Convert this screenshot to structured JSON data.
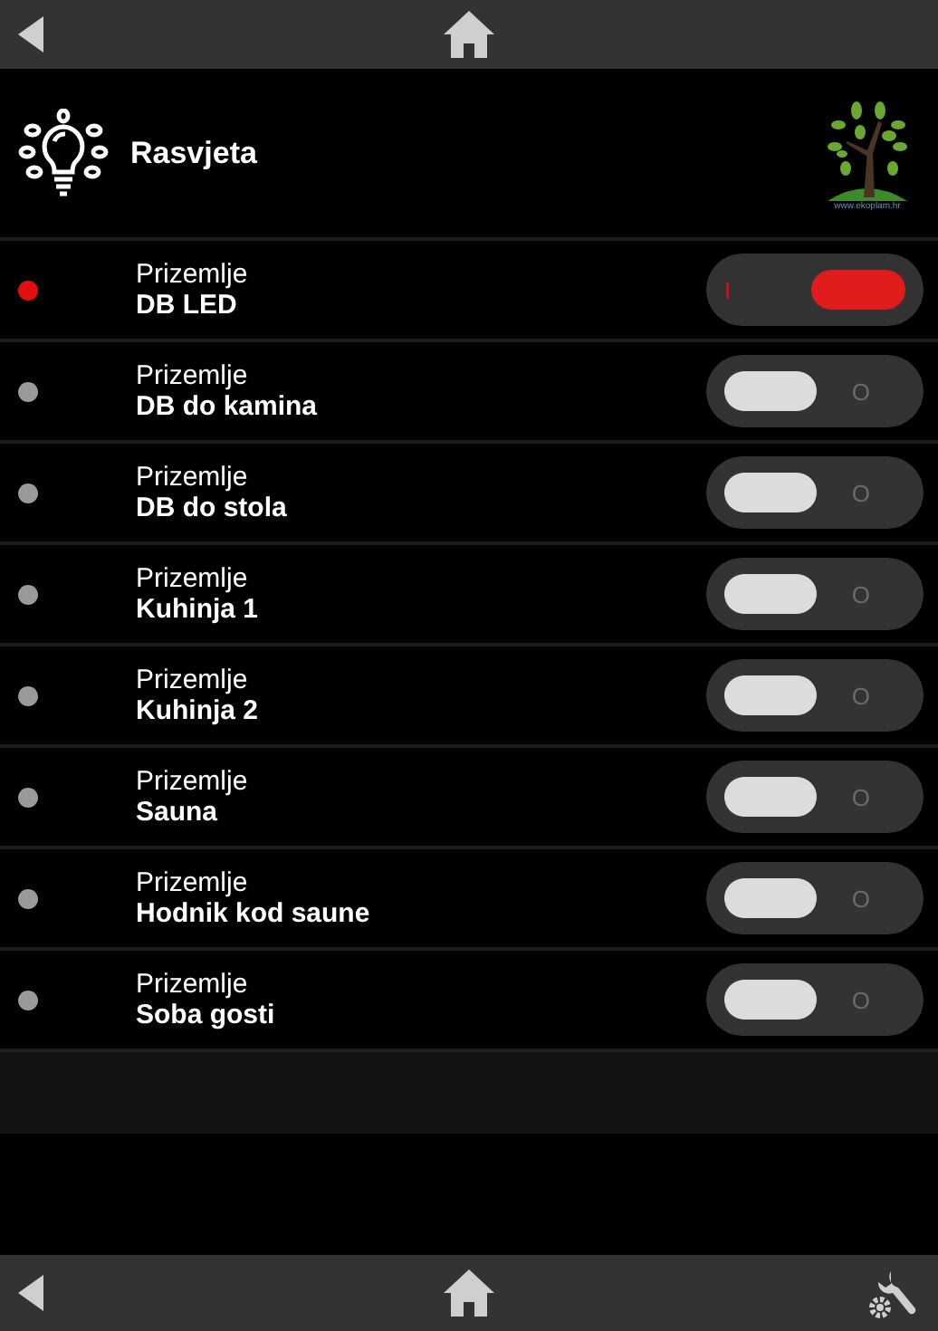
{
  "header": {
    "title": "Rasvjeta",
    "logo_caption": "www.ekoplam.hr"
  },
  "rows": [
    {
      "floor": "Prizemlje",
      "name": "DB LED",
      "on": true,
      "switch_label": "I"
    },
    {
      "floor": "Prizemlje",
      "name": "DB do kamina",
      "on": false,
      "switch_label": "O"
    },
    {
      "floor": "Prizemlje",
      "name": "DB do stola",
      "on": false,
      "switch_label": "O"
    },
    {
      "floor": "Prizemlje",
      "name": "Kuhinja 1",
      "on": false,
      "switch_label": "O"
    },
    {
      "floor": "Prizemlje",
      "name": "Kuhinja 2",
      "on": false,
      "switch_label": "O"
    },
    {
      "floor": "Prizemlje",
      "name": "Sauna",
      "on": false,
      "switch_label": "O"
    },
    {
      "floor": "Prizemlje",
      "name": "Hodnik kod saune",
      "on": false,
      "switch_label": "O"
    },
    {
      "floor": "Prizemlje",
      "name": "Soba gosti",
      "on": false,
      "switch_label": "O"
    }
  ]
}
